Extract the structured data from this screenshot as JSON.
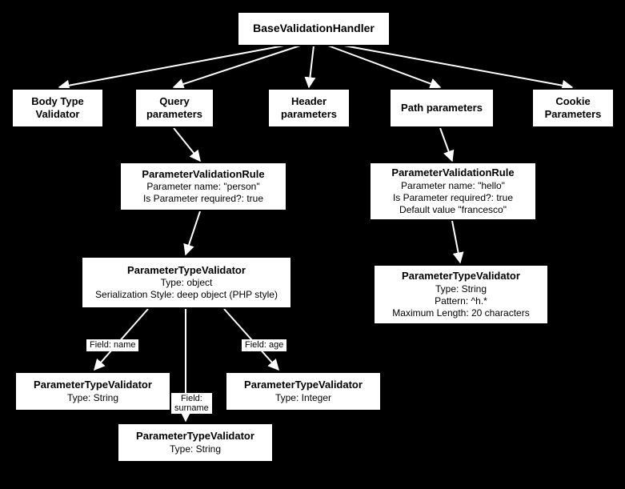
{
  "root": {
    "title": "BaseValidationHandler"
  },
  "handlers": {
    "body": {
      "line1": "Body Type",
      "line2": "Validator"
    },
    "query": {
      "line1": "Query",
      "line2": "parameters"
    },
    "header": {
      "line1": "Header",
      "line2": "parameters"
    },
    "path": {
      "line1": "Path parameters"
    },
    "cookie": {
      "line1": "Cookie",
      "line2": "Parameters"
    }
  },
  "rules": {
    "person": {
      "title": "ParameterValidationRule",
      "l1": "Parameter name: \"person\"",
      "l2": "Is Parameter required?: true"
    },
    "hello": {
      "title": "ParameterValidationRule",
      "l1": "Parameter name: \"hello\"",
      "l2": "Is Parameter required?: true",
      "l3": "Default value \"francesco\""
    }
  },
  "validators": {
    "object": {
      "title": "ParameterTypeValidator",
      "l1": "Type: object",
      "l2": "Serialization Style: deep object (PHP style)"
    },
    "helloStr": {
      "title": "ParameterTypeValidator",
      "l1": "Type: String",
      "l2": "Pattern: ^h.*",
      "l3": "Maximum Length: 20 characters"
    },
    "name": {
      "title": "ParameterTypeValidator",
      "l1": "Type: String"
    },
    "age": {
      "title": "ParameterTypeValidator",
      "l1": "Type: Integer"
    },
    "surname": {
      "title": "ParameterTypeValidator",
      "l1": "Type: String"
    }
  },
  "edgeLabels": {
    "name": "Field: name",
    "age": "Field: age",
    "surname": {
      "l1": "Field:",
      "l2": "surname"
    }
  }
}
